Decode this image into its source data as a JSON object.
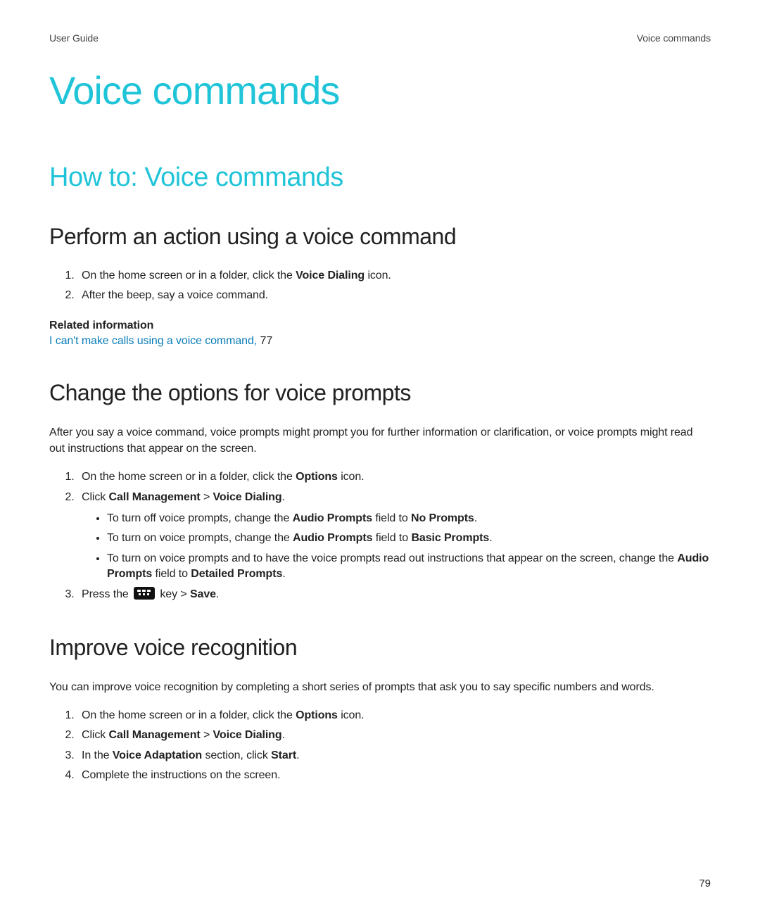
{
  "header": {
    "left": "User Guide",
    "right": "Voice commands"
  },
  "page_title": "Voice commands",
  "section_title": "How to: Voice commands",
  "sections": {
    "perform": {
      "title": "Perform an action using a voice command",
      "step1_pre": "On the home screen or in a folder, click the ",
      "step1_bold": "Voice Dialing",
      "step1_post": " icon.",
      "step2": "After the beep, say a voice command.",
      "related_heading": "Related information",
      "related_link_text": "I can't make calls using a voice command, ",
      "related_link_page": "77"
    },
    "change": {
      "title": "Change the options for voice prompts",
      "intro": "After you say a voice command, voice prompts might prompt you for further information or clarification, or voice prompts might read out instructions that appear on the screen.",
      "step1_pre": "On the home screen or in a folder, click the ",
      "step1_bold": "Options",
      "step1_post": " icon.",
      "step2_pre": "Click ",
      "step2_bold1": "Call Management",
      "step2_sep": " > ",
      "step2_bold2": "Voice Dialing",
      "step2_post": ".",
      "bullet1_pre": "To turn off voice prompts, change the ",
      "bullet1_bold1": "Audio Prompts",
      "bullet1_mid": " field to ",
      "bullet1_bold2": "No Prompts",
      "bullet1_post": ".",
      "bullet2_pre": "To turn on voice prompts, change the ",
      "bullet2_bold1": "Audio Prompts",
      "bullet2_mid": " field to ",
      "bullet2_bold2": "Basic Prompts",
      "bullet2_post": ".",
      "bullet3_pre": "To turn on voice prompts and to have the voice prompts read out instructions that appear on the screen, change the ",
      "bullet3_bold1": "Audio Prompts",
      "bullet3_mid": " field to ",
      "bullet3_bold2": "Detailed Prompts",
      "bullet3_post": ".",
      "step3_pre": "Press the ",
      "step3_mid": " key > ",
      "step3_bold": "Save",
      "step3_post": "."
    },
    "improve": {
      "title": "Improve voice recognition",
      "intro": "You can improve voice recognition by completing a short series of prompts that ask you to say specific numbers and words.",
      "step1_pre": "On the home screen or in a folder, click the ",
      "step1_bold": "Options",
      "step1_post": " icon.",
      "step2_pre": "Click ",
      "step2_bold1": "Call Management",
      "step2_sep": " > ",
      "step2_bold2": "Voice Dialing",
      "step2_post": ".",
      "step3_pre": "In the ",
      "step3_bold1": "Voice Adaptation",
      "step3_mid": " section, click ",
      "step3_bold2": "Start",
      "step3_post": ".",
      "step4": "Complete the instructions on the screen."
    }
  },
  "page_number": "79"
}
